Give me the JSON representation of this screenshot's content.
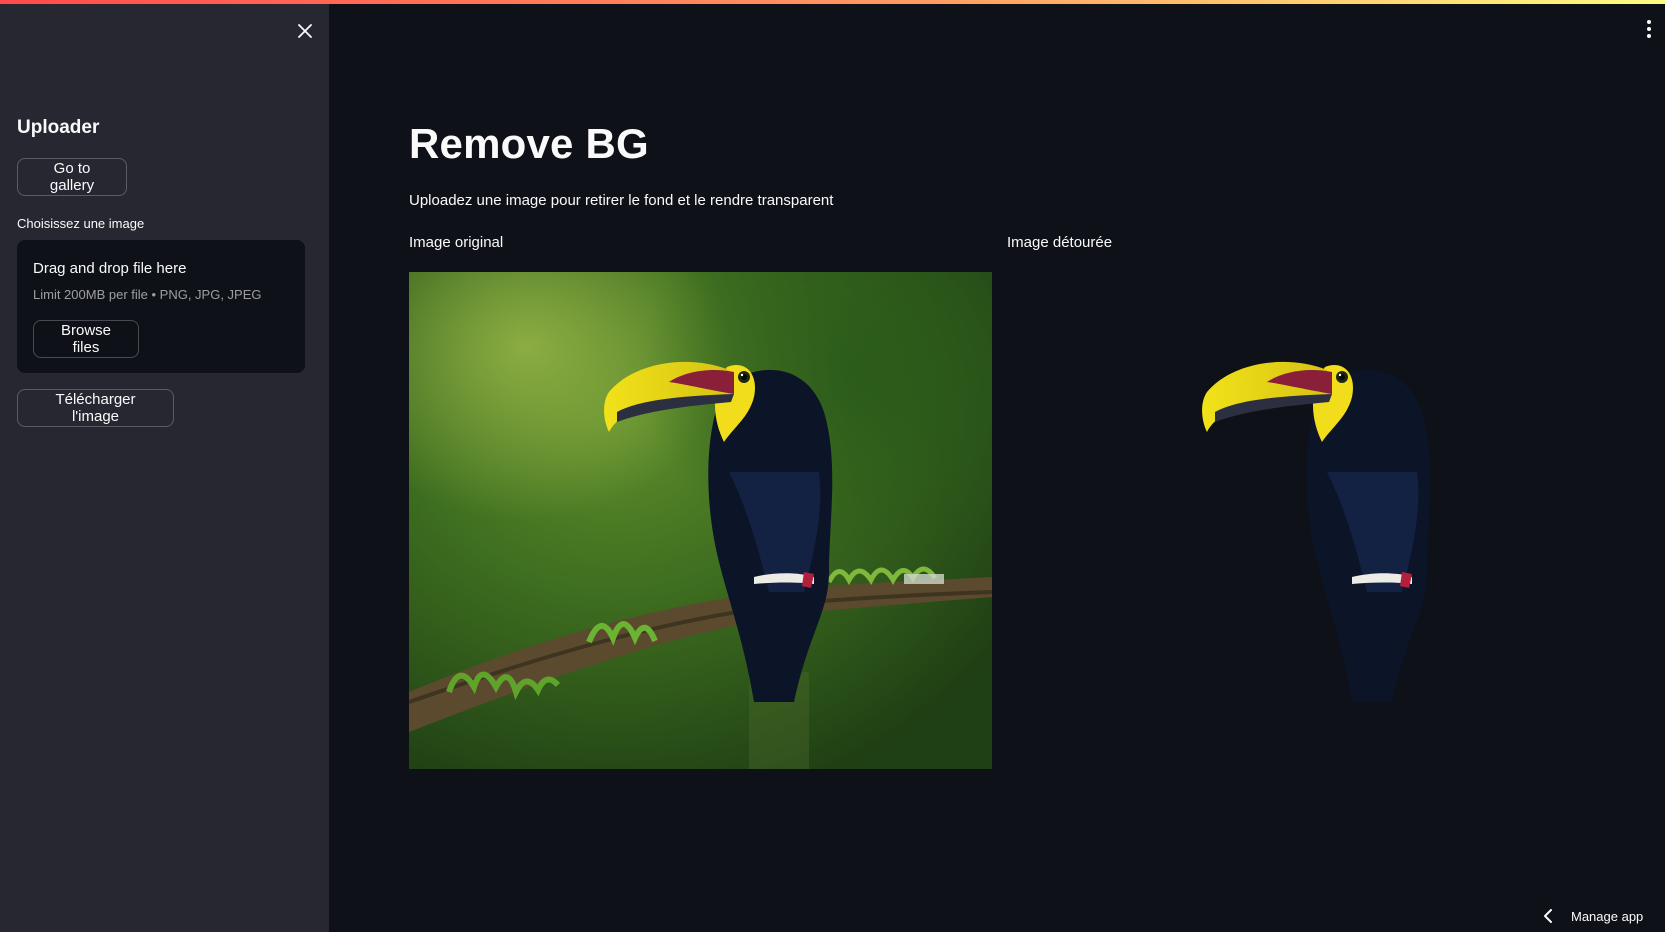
{
  "sidebar": {
    "title": "Uploader",
    "gallery_button": "Go to gallery",
    "upload_label": "Choisissez une image",
    "dropzone_title": "Drag and drop file here",
    "dropzone_hint": "Limit 200MB per file • PNG, JPG, JPEG",
    "browse_button": "Browse files",
    "download_button": "Télécharger l'image"
  },
  "main": {
    "title": "Remove BG",
    "subtitle": "Uploadez une image pour retirer le fond et le rendre transparent",
    "left_label": "Image original",
    "right_label": "Image détourée"
  },
  "footer": {
    "manage_app": "Manage app"
  },
  "icons": {
    "close": "close-icon",
    "menu": "kebab-menu-icon",
    "chevron": "chevron-left-icon"
  },
  "colors": {
    "background": "#0e1117",
    "sidebar": "#262730",
    "accent": "#ff4b4b"
  }
}
